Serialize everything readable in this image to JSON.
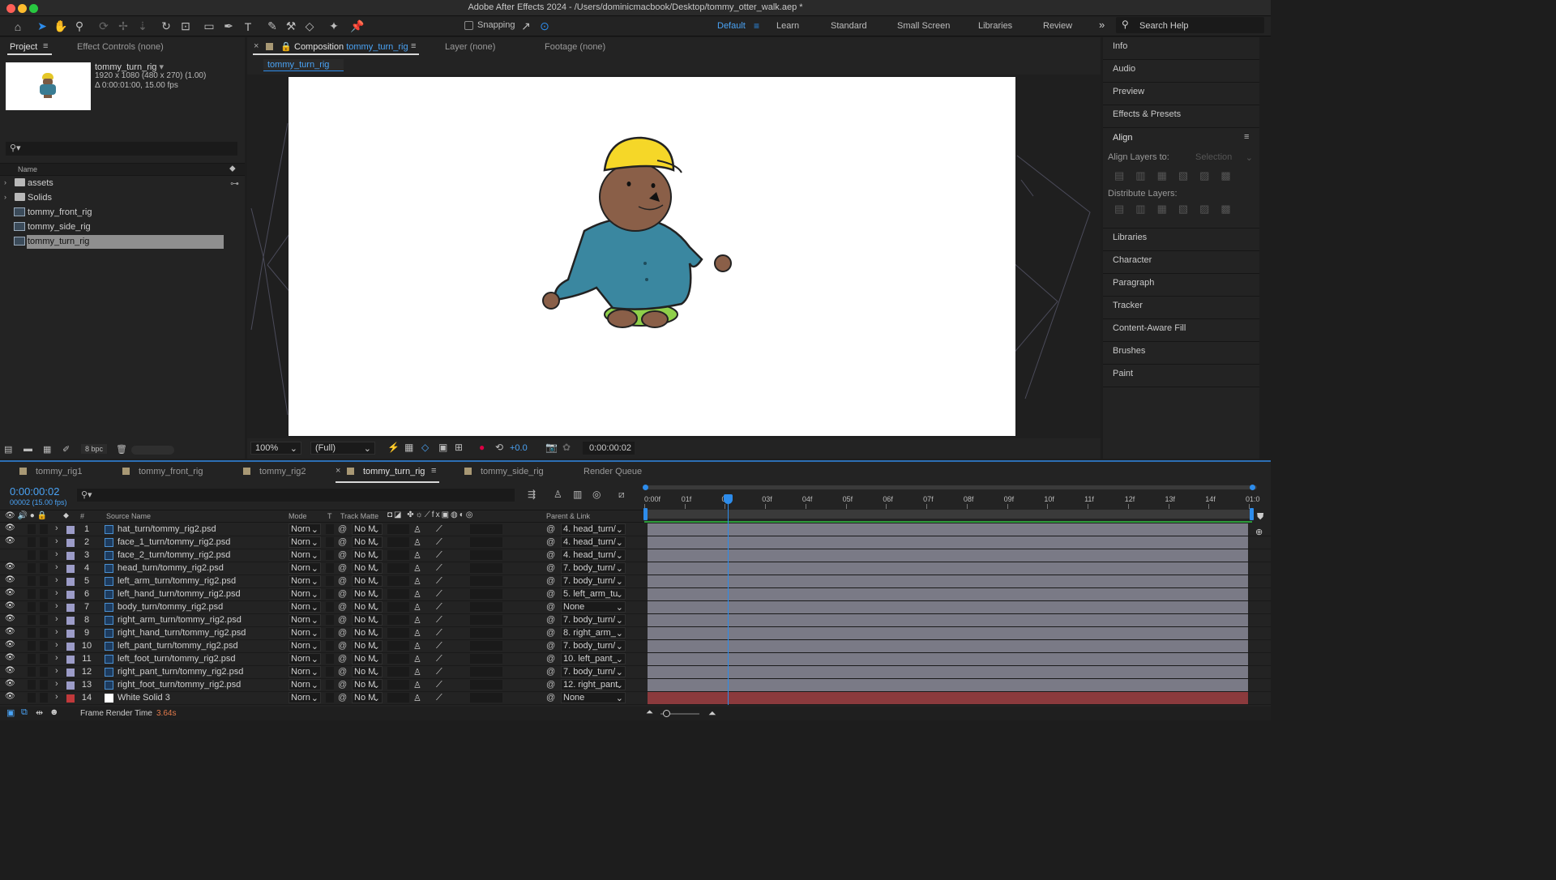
{
  "window": {
    "title": "Adobe After Effects 2024 - /Users/dominicmacbook/Desktop/tommy_otter_walk.aep *"
  },
  "toolbar": {
    "snapping_label": "Snapping",
    "workspaces": [
      "Default",
      "Learn",
      "Standard",
      "Small Screen",
      "Libraries",
      "Review"
    ],
    "active_workspace": "Default",
    "search_placeholder": "Search Help",
    "overflow": "»"
  },
  "project": {
    "tab": "Project",
    "tab2": "Effect Controls (none)",
    "comp_name": "tommy_turn_rig",
    "dims": "1920 x 1080  (480 x 270) (1.00)",
    "duration": "Δ 0:00:01:00, 15.00 fps",
    "col_name": "Name",
    "items": [
      {
        "name": "assets",
        "type": "folder"
      },
      {
        "name": "Solids",
        "type": "folder"
      },
      {
        "name": "tommy_front_rig",
        "type": "comp"
      },
      {
        "name": "tommy_side_rig",
        "type": "comp"
      },
      {
        "name": "tommy_turn_rig",
        "type": "comp",
        "selected": true
      }
    ],
    "bpc": "8 bpc"
  },
  "composition": {
    "tab_prefix": "Composition",
    "tab_name": "tommy_turn_rig",
    "layer_tab": "Layer (none)",
    "footage_tab": "Footage (none)",
    "sub_tab": "tommy_turn_rig",
    "zoom": "100%",
    "resolution": "(Full)",
    "exposure": "+0.0",
    "timecode": "0:00:00:02"
  },
  "right_panel": {
    "items": [
      "Info",
      "Audio",
      "Preview",
      "Effects & Presets"
    ],
    "align_title": "Align",
    "align_to_label": "Align Layers to:",
    "align_to_value": "Selection",
    "distribute_label": "Distribute Layers:",
    "lower_items": [
      "Libraries",
      "Character",
      "Paragraph",
      "Tracker",
      "Content-Aware Fill",
      "Brushes",
      "Paint"
    ]
  },
  "timeline": {
    "tabs": [
      "tommy_rig1",
      "tommy_front_rig",
      "tommy_rig2",
      "tommy_turn_rig",
      "tommy_side_rig",
      "Render Queue"
    ],
    "active_tab": "tommy_turn_rig",
    "timecode": "0:00:00:02",
    "frame_info": "00002 (15.00 fps)",
    "headers": {
      "num": "#",
      "source": "Source Name",
      "mode": "Mode",
      "t": "T",
      "matte": "Track Matte",
      "parent": "Parent & Link"
    },
    "ruler": [
      "0:00f",
      "01f",
      "02f",
      "03f",
      "04f",
      "05f",
      "06f",
      "07f",
      "08f",
      "09f",
      "10f",
      "11f",
      "12f",
      "13f",
      "14f",
      "01:0"
    ],
    "playhead_frame": 2,
    "total_frames": 15,
    "layers": [
      {
        "num": "1",
        "name": "hat_turn/tommy_rig2.psd",
        "mode": "Norn",
        "matte": "No M",
        "parent": "4. head_turn/",
        "visible": true,
        "label": "#9c9cc8"
      },
      {
        "num": "2",
        "name": "face_1_turn/tommy_rig2.psd",
        "mode": "Norn",
        "matte": "No M",
        "parent": "4. head_turn/",
        "visible": true,
        "label": "#9c9cc8"
      },
      {
        "num": "3",
        "name": "face_2_turn/tommy_rig2.psd",
        "mode": "Norn",
        "matte": "No M",
        "parent": "4. head_turn/",
        "visible": false,
        "label": "#9c9cc8"
      },
      {
        "num": "4",
        "name": "head_turn/tommy_rig2.psd",
        "mode": "Norn",
        "matte": "No M",
        "parent": "7. body_turn/",
        "visible": true,
        "label": "#9c9cc8"
      },
      {
        "num": "5",
        "name": "left_arm_turn/tommy_rig2.psd",
        "mode": "Norn",
        "matte": "No M",
        "parent": "7. body_turn/",
        "visible": true,
        "label": "#9c9cc8"
      },
      {
        "num": "6",
        "name": "left_hand_turn/tommy_rig2.psd",
        "mode": "Norn",
        "matte": "No M",
        "parent": "5. left_arm_tu",
        "visible": true,
        "label": "#9c9cc8"
      },
      {
        "num": "7",
        "name": "body_turn/tommy_rig2.psd",
        "mode": "Norn",
        "matte": "No M",
        "parent": "None",
        "visible": true,
        "label": "#9c9cc8"
      },
      {
        "num": "8",
        "name": "right_arm_turn/tommy_rig2.psd",
        "mode": "Norn",
        "matte": "No M",
        "parent": "7. body_turn/",
        "visible": true,
        "label": "#9c9cc8"
      },
      {
        "num": "9",
        "name": "right_hand_turn/tommy_rig2.psd",
        "mode": "Norn",
        "matte": "No M",
        "parent": "8. right_arm_",
        "visible": true,
        "label": "#9c9cc8"
      },
      {
        "num": "10",
        "name": "left_pant_turn/tommy_rig2.psd",
        "mode": "Norn",
        "matte": "No M",
        "parent": "7. body_turn/",
        "visible": true,
        "label": "#9c9cc8"
      },
      {
        "num": "11",
        "name": "left_foot_turn/tommy_rig2.psd",
        "mode": "Norn",
        "matte": "No M",
        "parent": "10. left_pant_",
        "visible": true,
        "label": "#9c9cc8"
      },
      {
        "num": "12",
        "name": "right_pant_turn/tommy_rig2.psd",
        "mode": "Norn",
        "matte": "No M",
        "parent": "7. body_turn/",
        "visible": true,
        "label": "#9c9cc8"
      },
      {
        "num": "13",
        "name": "right_foot_turn/tommy_rig2.psd",
        "mode": "Norn",
        "matte": "No M",
        "parent": "12. right_pant",
        "visible": true,
        "label": "#9c9cc8"
      },
      {
        "num": "14",
        "name": "White Solid 3",
        "mode": "Norn",
        "matte": "No M",
        "parent": "None",
        "visible": true,
        "label": "#c0393b",
        "solid": true
      }
    ],
    "footer": {
      "label": "Frame Render Time",
      "value": "3.64s"
    }
  },
  "colors": {
    "accent": "#2d8ceb",
    "active_tab_text": "#4aa3f5",
    "layer_bar": "#7a7a86",
    "solid_bar": "#8b3a3d",
    "work_area": "#2c9b3a"
  }
}
